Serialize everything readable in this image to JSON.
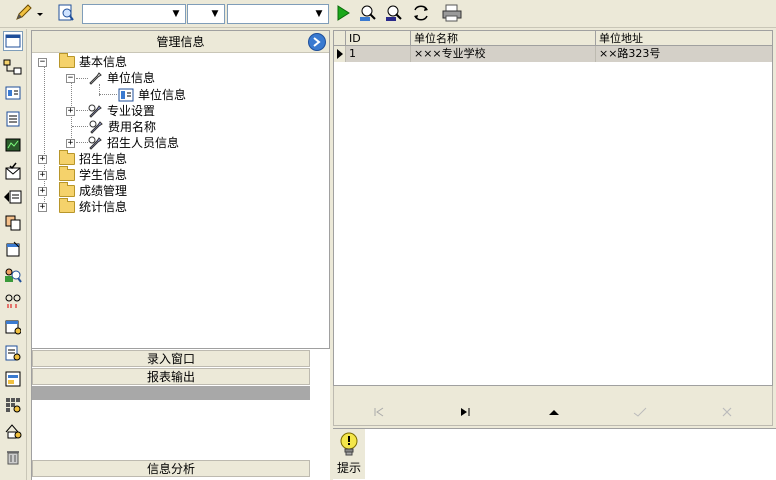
{
  "toolbar": {
    "combo1_value": "",
    "combo2_value": "",
    "combo3_value": ""
  },
  "tree": {
    "header": "管理信息",
    "nodes": {
      "basic": "基本信息",
      "unit": "单位信息",
      "unit_child": "单位信息",
      "major": "专业设置",
      "fee": "费用名称",
      "recruiter": "招生人员信息",
      "enroll": "招生信息",
      "student": "学生信息",
      "grades": "成绩管理",
      "stats": "统计信息"
    }
  },
  "panels": {
    "entry": "录入窗口",
    "report": "报表输出",
    "analysis": "信息分析"
  },
  "grid": {
    "columns": [
      "ID",
      "单位名称",
      "单位地址"
    ],
    "rows": [
      [
        "1",
        "×××专业学校",
        "××路323号"
      ]
    ]
  },
  "hint": {
    "label": "提示"
  },
  "colors": {
    "accent": "#3a7ad0",
    "folder": "#f5d26b",
    "selected_row": "#d4d0c8"
  }
}
